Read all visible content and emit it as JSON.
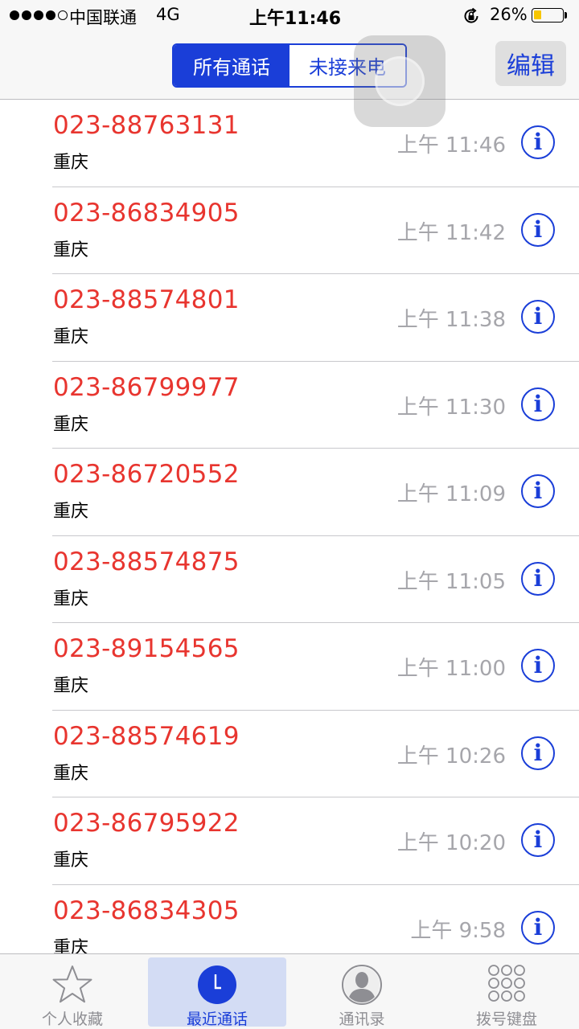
{
  "status_bar": {
    "signal_dots": 5,
    "signal_filled": 4,
    "carrier": "中国联通",
    "network": "4G",
    "time": "上午11:46",
    "battery_percent": "26%",
    "battery_level": 0.26
  },
  "nav": {
    "segments": [
      "所有通话",
      "未接来电"
    ],
    "selected_segment": 0,
    "edit_label": "编辑"
  },
  "calls": [
    {
      "number": "023-88763131",
      "location": "重庆",
      "time": "上午 11:46"
    },
    {
      "number": "023-86834905",
      "location": "重庆",
      "time": "上午 11:42"
    },
    {
      "number": "023-88574801",
      "location": "重庆",
      "time": "上午 11:38"
    },
    {
      "number": "023-86799977",
      "location": "重庆",
      "time": "上午 11:30"
    },
    {
      "number": "023-86720552",
      "location": "重庆",
      "time": "上午 11:09"
    },
    {
      "number": "023-88574875",
      "location": "重庆",
      "time": "上午 11:05"
    },
    {
      "number": "023-89154565",
      "location": "重庆",
      "time": "上午 11:00"
    },
    {
      "number": "023-88574619",
      "location": "重庆",
      "time": "上午 10:26"
    },
    {
      "number": "023-86795922",
      "location": "重庆",
      "time": "上午 10:20"
    },
    {
      "number": "023-86834305",
      "location": "重庆",
      "time": "上午 9:58"
    }
  ],
  "info_glyph": "i",
  "tabs": [
    {
      "label": "个人收藏",
      "icon": "star-icon"
    },
    {
      "label": "最近通话",
      "icon": "clock-icon"
    },
    {
      "label": "通讯录",
      "icon": "contact-icon"
    },
    {
      "label": "拨号键盘",
      "icon": "keypad-icon"
    }
  ],
  "active_tab": 1,
  "colors": {
    "accent": "#1a3ed8",
    "missed_call": "#e8352f",
    "secondary_text": "#a6a6ab"
  }
}
